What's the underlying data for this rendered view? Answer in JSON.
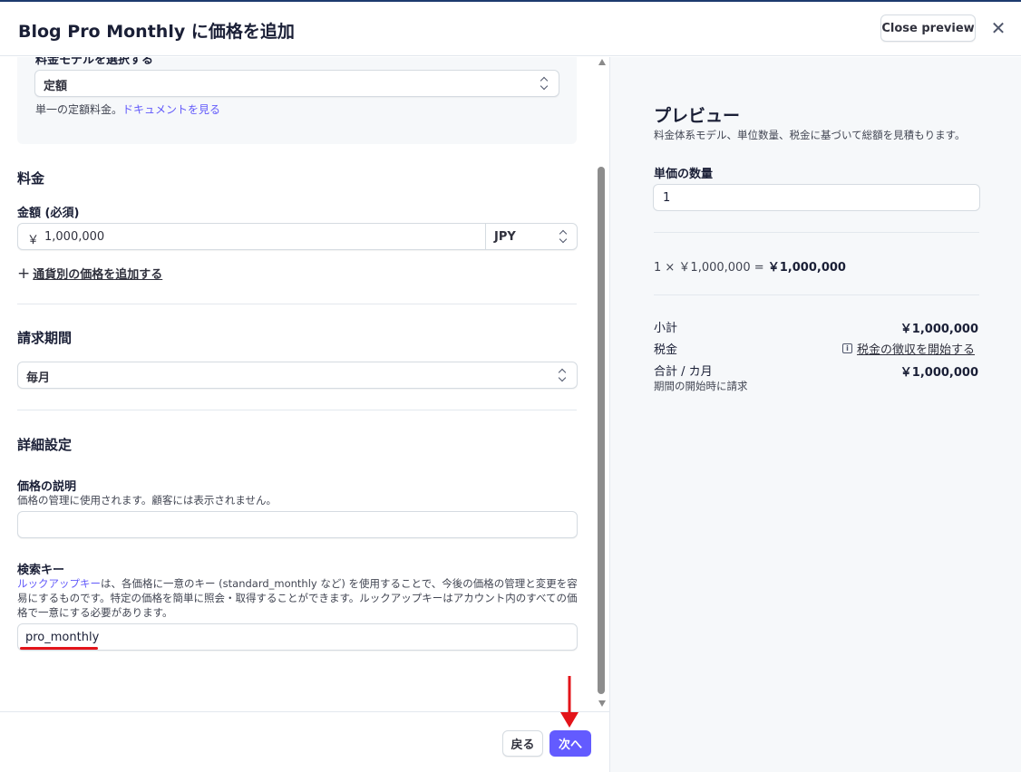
{
  "header": {
    "title": "Blog Pro Monthly に価格を追加",
    "close_preview_label": "Close preview",
    "close_icon": "✕"
  },
  "pricing_model": {
    "label": "料金モデルを選択する",
    "selected": "定額",
    "description": "単一の定額料金。",
    "doc_link": "ドキュメントを見る"
  },
  "price": {
    "section_title": "料金",
    "amount_label": "金額 (必須)",
    "currency_symbol": "￥",
    "amount_value": "1,000,000",
    "currency": "JPY",
    "add_currency_label": "通貨別の価格を追加する"
  },
  "billing": {
    "section_title": "請求期間",
    "selected": "毎月"
  },
  "advanced": {
    "section_title": "詳細設定",
    "description_label": "価格の説明",
    "description_help": "価格の管理に使用されます。顧客には表示されません。",
    "description_value": "",
    "lookup_label": "検索キー",
    "lookup_link": "ルックアップキー",
    "lookup_help": "は、各価格に一意のキー (standard_monthly など) を使用することで、今後の価格の管理と変更を容易にするものです。特定の価格を簡単に照会・取得することができます。ルックアップキーはアカウント内のすべての価格で一意にする必要があります。",
    "lookup_value": "pro_monthly"
  },
  "footer": {
    "back_label": "戻る",
    "next_label": "次へ"
  },
  "preview": {
    "title": "プレビュー",
    "subtitle": "料金体系モデル、単位数量、税金に基づいて総額を見積もります。",
    "unit_label": "単価の数量",
    "unit_value": "1",
    "calc_left": "1 × ￥1,000,000 =",
    "calc_total": "￥1,000,000",
    "subtotal_label": "小計",
    "subtotal_value": "￥1,000,000",
    "tax_label": "税金",
    "tax_link": "税金の徴収を開始する",
    "total_label": "合計 / カ月",
    "total_value": "￥1,000,000",
    "billing_note": "期間の開始時に請求"
  },
  "colors": {
    "accent": "#635bff",
    "link": "#625afa",
    "annotation_red": "#e3141a"
  }
}
